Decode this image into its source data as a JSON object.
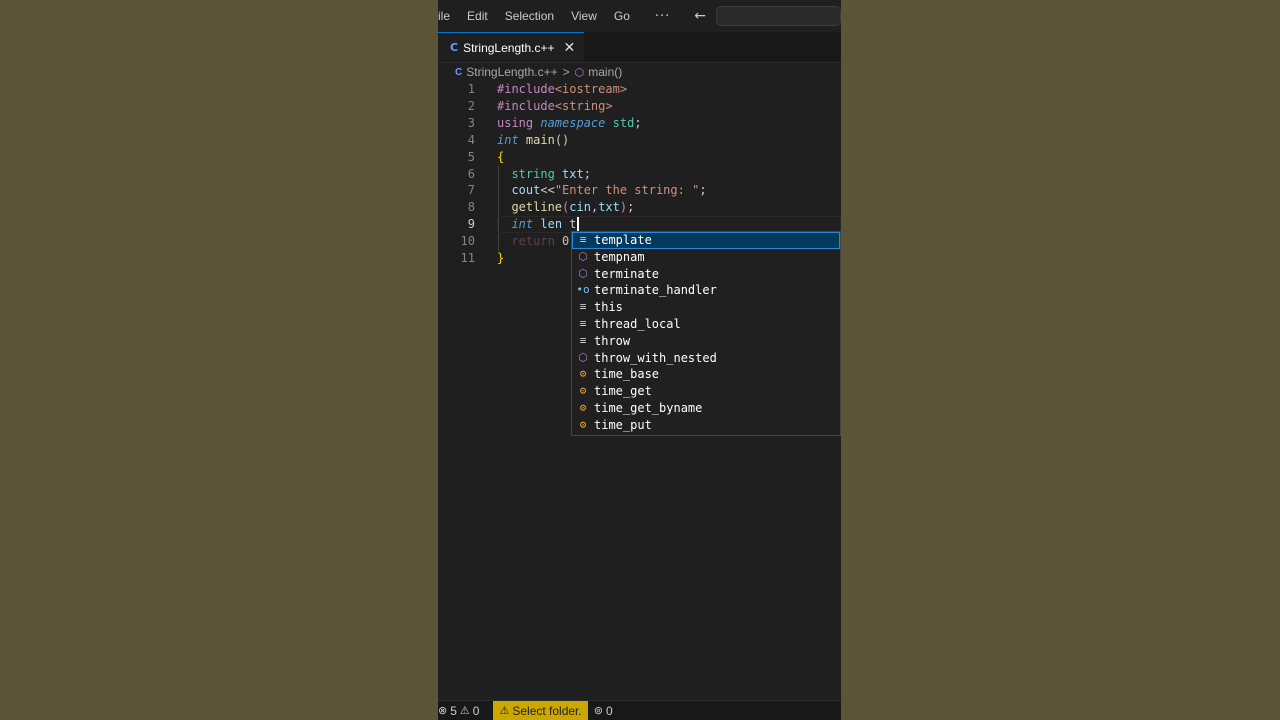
{
  "menu": {
    "items": [
      "ile",
      "Edit",
      "Selection",
      "View",
      "Go"
    ],
    "more": "···",
    "back_arrow": "←",
    "forward_arrow": "→"
  },
  "tab": {
    "icon": "C",
    "label": "StringLength.c++",
    "close": "✕"
  },
  "breadcrumb": {
    "file_icon": "C",
    "file": "StringLength.c++",
    "separator": ">",
    "symbol_icon": "cube-icon",
    "symbol": "main()"
  },
  "editor": {
    "active_line": 9,
    "lines": [
      {
        "n": "1",
        "tokens": [
          [
            "pp",
            "#include"
          ],
          [
            "str",
            "<iostream>"
          ]
        ]
      },
      {
        "n": "2",
        "tokens": [
          [
            "pp",
            "#include"
          ],
          [
            "str",
            "<string>"
          ]
        ]
      },
      {
        "n": "3",
        "tokens": [
          [
            "ctl",
            "using"
          ],
          [
            "pl",
            " "
          ],
          [
            "kw italic",
            "namespace"
          ],
          [
            "pl",
            " "
          ],
          [
            "typ",
            "std"
          ],
          [
            "pl",
            ";"
          ]
        ]
      },
      {
        "n": "4",
        "tokens": [
          [
            "kw italic",
            "int"
          ],
          [
            "pl",
            " "
          ],
          [
            "fn",
            "main"
          ],
          [
            "pl",
            "()"
          ]
        ]
      },
      {
        "n": "5",
        "tokens": [
          [
            "brace",
            "{"
          ]
        ]
      },
      {
        "n": "6",
        "tokens": [
          [
            "pl",
            "  "
          ],
          [
            "typ",
            "string"
          ],
          [
            "pl",
            " "
          ],
          [
            "var",
            "txt"
          ],
          [
            "pl",
            ";"
          ]
        ]
      },
      {
        "n": "7",
        "tokens": [
          [
            "pl",
            "  "
          ],
          [
            "var",
            "cout"
          ],
          [
            "pl",
            "<<"
          ],
          [
            "str",
            "\"Enter the string: \""
          ],
          [
            "pl",
            ";"
          ]
        ]
      },
      {
        "n": "8",
        "tokens": [
          [
            "pl",
            "  "
          ],
          [
            "fn",
            "getline"
          ],
          [
            "paren",
            "("
          ],
          [
            "var",
            "cin"
          ],
          [
            "pl",
            ","
          ],
          [
            "var",
            "txt"
          ],
          [
            "paren",
            ")"
          ],
          [
            "pl",
            ";"
          ]
        ]
      },
      {
        "n": "9",
        "tokens": [
          [
            "pl",
            "  "
          ],
          [
            "kw italic",
            "int"
          ],
          [
            "pl",
            " "
          ],
          [
            "var",
            "len"
          ],
          [
            "pl",
            " t"
          ]
        ]
      },
      {
        "n": "10",
        "tokens": [
          [
            "pl",
            "  "
          ],
          [
            "ctl",
            "return"
          ],
          [
            "pl",
            " "
          ],
          [
            "num",
            "0"
          ],
          [
            "pl",
            ";"
          ]
        ]
      },
      {
        "n": "11",
        "tokens": [
          [
            "brace",
            "}"
          ]
        ]
      }
    ]
  },
  "suggestions": [
    {
      "icon": "keyword-icon",
      "glyph": "≡",
      "kind": "plain",
      "label": "template",
      "selected": true
    },
    {
      "icon": "method-icon",
      "glyph": "⬡",
      "kind": "method",
      "label": "tempnam",
      "selected": false
    },
    {
      "icon": "method-icon",
      "glyph": "⬡",
      "kind": "method",
      "label": "terminate",
      "selected": false
    },
    {
      "icon": "variable-icon",
      "glyph": "•o",
      "kind": "var",
      "label": "terminate_handler",
      "selected": false
    },
    {
      "icon": "keyword-icon",
      "glyph": "≡",
      "kind": "plain",
      "label": "this",
      "selected": false
    },
    {
      "icon": "keyword-icon",
      "glyph": "≡",
      "kind": "plain",
      "label": "thread_local",
      "selected": false
    },
    {
      "icon": "keyword-icon",
      "glyph": "≡",
      "kind": "plain",
      "label": "throw",
      "selected": false
    },
    {
      "icon": "method-icon",
      "glyph": "⬡",
      "kind": "method",
      "label": "throw_with_nested",
      "selected": false
    },
    {
      "icon": "class-icon",
      "glyph": "⚙",
      "kind": "class",
      "label": "time_base",
      "selected": false
    },
    {
      "icon": "class-icon",
      "glyph": "⚙",
      "kind": "class",
      "label": "time_get",
      "selected": false
    },
    {
      "icon": "class-icon",
      "glyph": "⚙",
      "kind": "class",
      "label": "time_get_byname",
      "selected": false
    },
    {
      "icon": "class-icon",
      "glyph": "⚙",
      "kind": "class",
      "label": "time_put",
      "selected": false
    }
  ],
  "statusbar": {
    "errors": "5",
    "warnings": "0",
    "select_folder": "Select folder.",
    "ports": "0"
  }
}
